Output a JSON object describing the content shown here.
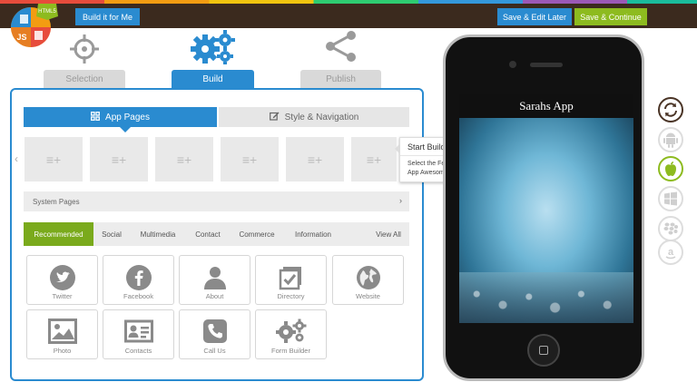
{
  "header": {
    "build_label": "Build it for Me",
    "save_edit_label": "Save & Edit Later",
    "save_continue_label": "Save & Continue"
  },
  "steps": {
    "selection": "Selection",
    "build": "Build",
    "publish": "Publish"
  },
  "logo": {
    "badge": "HTML5",
    "letters": "JS"
  },
  "segments": {
    "app_pages": "App Pages",
    "style_nav": "Style & Navigation"
  },
  "page_slots": [
    "≡+",
    "≡+",
    "≡+",
    "≡+",
    "≡+",
    "≡+"
  ],
  "tooltip": {
    "title": "Start Building Your App!",
    "body": "Select the Features listed below and make the App Awesome!"
  },
  "system_pages": "System Pages",
  "categories": {
    "recommended": "Recommended",
    "social": "Social",
    "multimedia": "Multimedia",
    "contact": "Contact",
    "commerce": "Commerce",
    "information": "Information",
    "view_all": "View All"
  },
  "features": {
    "twitter": "Twitter",
    "facebook": "Facebook",
    "about": "About",
    "directory": "Directory",
    "website": "Website",
    "photo": "Photo",
    "contacts": "Contacts",
    "call_us": "Call Us",
    "form_builder": "Form Builder"
  },
  "phone": {
    "app_title": "Sarahs App"
  },
  "colors": {
    "accent_blue": "#2a8bd0",
    "accent_green": "#8dbb1f",
    "header_bg": "#3b2a1e"
  }
}
